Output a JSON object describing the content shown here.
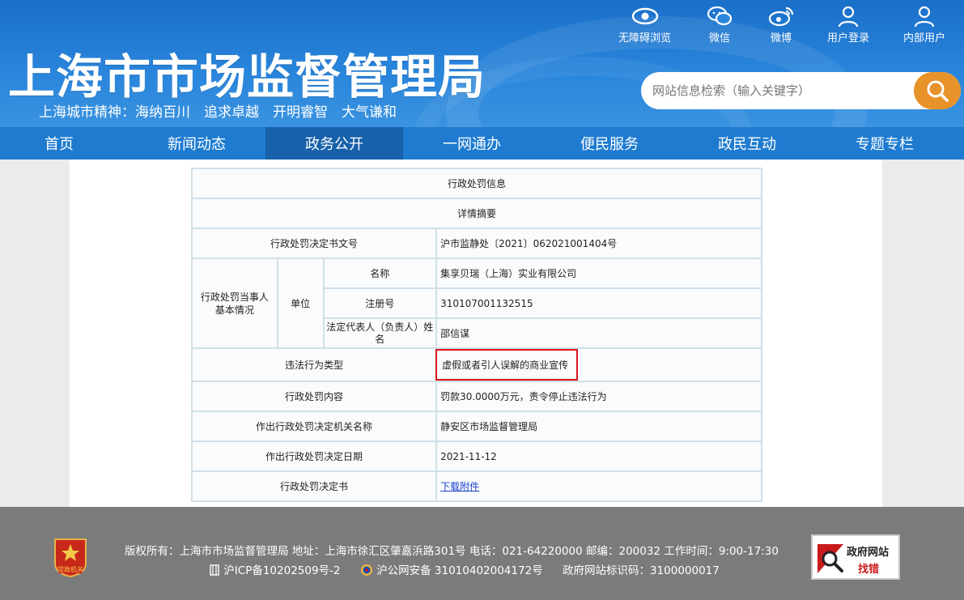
{
  "header": {
    "site_title": "上海市市场监督管理局",
    "slogan": "上海城市精神：海纳百川　追求卓越　开明睿智　大气谦和",
    "tools": [
      {
        "label": "无障碍浏览",
        "icon": "eye-icon"
      },
      {
        "label": "微信",
        "icon": "wechat-icon"
      },
      {
        "label": "微博",
        "icon": "weibo-icon"
      },
      {
        "label": "用户登录",
        "icon": "user-icon"
      },
      {
        "label": "内部用户",
        "icon": "user-icon"
      }
    ],
    "search": {
      "placeholder": "网站信息检索（输入关键字）"
    }
  },
  "nav": {
    "items": [
      "首页",
      "新闻动态",
      "政务公开",
      "一网通办",
      "便民服务",
      "政民互动",
      "专题专栏"
    ],
    "active": "政务公开"
  },
  "table": {
    "title": "行政处罚信息",
    "subtitle": "详情摘要",
    "doc_no_label": "行政处罚决定书文号",
    "doc_no_value": "沪市监静处〔2021〕062021001404号",
    "party_label": "行政处罚当事人基本情况",
    "unit_label": "单位",
    "name_label": "名称",
    "name_value": "集享贝瑞（上海）实业有限公司",
    "reg_label": "注册号",
    "reg_value": "310107001132515",
    "rep_label": "法定代表人（负责人）姓名",
    "rep_value": "邵信谋",
    "violation_label": "违法行为类型",
    "violation_value": "虚假或者引人误解的商业宣传",
    "content_label": "行政处罚内容",
    "content_value": "罚款30.0000万元，责令停止违法行为",
    "org_label": "作出行政处罚决定机关名称",
    "org_value": "静安区市场监督管理局",
    "date_label": "作出行政处罚决定日期",
    "date_value": "2021-11-12",
    "doc_label": "行政处罚决定书",
    "doc_link": "下载附件"
  },
  "footer": {
    "line1": "版权所有：上海市市场监督管理局 地址：上海市徐汇区肇嘉浜路301号 电话：021-64220000 邮编：200032 工作时间：9:00-17:30",
    "icp": "沪ICP备10202509号-2",
    "police": "沪公网安备 31010402004172号",
    "site_code": "政府网站标识码：3100000017",
    "party_logo_text": "党政机关",
    "error_badge_line1": "政府网站",
    "error_badge_line2": "找错"
  },
  "colors": {
    "header_blue": "#1a6fc9",
    "nav_blue": "#1e7bd0",
    "nav_active": "#1760aa",
    "search_orange": "#e8922a",
    "highlight_red": "#d9141a",
    "footer_gray": "#7b7b7b"
  }
}
